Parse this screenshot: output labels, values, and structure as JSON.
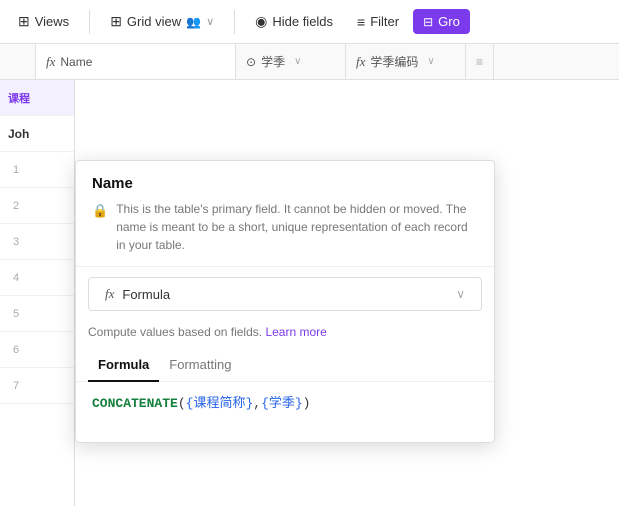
{
  "toolbar": {
    "views_label": "Views",
    "grid_view_label": "Grid view",
    "hide_fields_label": "Hide fields",
    "filter_label": "Filter",
    "group_label": "Gro",
    "views_icon": "⊞",
    "hide_icon": "◎",
    "filter_icon": "≡",
    "group_icon": "⊟"
  },
  "columns": {
    "name_icon": "fx",
    "name_label": "Name",
    "season_icon": "⊙",
    "season_label": "学季",
    "season_code_icon": "fx",
    "season_code_label": "学季编码",
    "extra_icon": "≡"
  },
  "table": {
    "header_col1": "课程",
    "header_col2": "Joh",
    "rows": [
      "1",
      "2",
      "3",
      "4",
      "5",
      "6",
      "7"
    ]
  },
  "panel": {
    "title": "Name",
    "description": "This is the table's primary field. It cannot be hidden or moved. The name is meant to be a short, unique representation of each record in your table.",
    "formula_type": "Formula",
    "formula_icon": "fx",
    "learn_more_text": "Compute values based on fields.",
    "learn_more_link": "Learn more",
    "tab_formula": "Formula",
    "tab_formatting": "Formatting",
    "formula_content": "CONCATENATE({课程简称},{学季})"
  }
}
